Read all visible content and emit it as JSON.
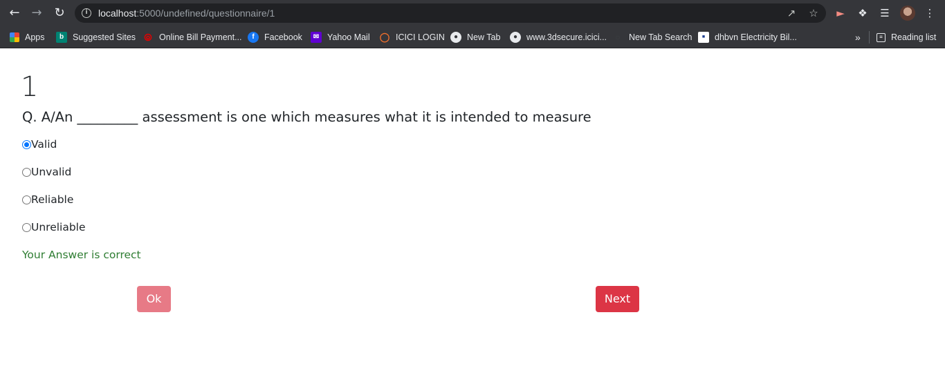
{
  "browser": {
    "url_host": "localhost",
    "url_rest": ":5000/undefined/questionnaire/1",
    "bookmarks": [
      {
        "label": "Apps",
        "icon": "apps-grid-icon"
      },
      {
        "label": "Suggested Sites",
        "icon": "bing-icon"
      },
      {
        "label": "Online Bill Payment...",
        "icon": "airtel-icon"
      },
      {
        "label": "Facebook",
        "icon": "facebook-icon"
      },
      {
        "label": "Yahoo Mail",
        "icon": "yahoo-mail-icon"
      },
      {
        "label": "ICICI LOGIN",
        "icon": "icici-icon"
      },
      {
        "label": "New Tab",
        "icon": "globe-icon"
      },
      {
        "label": "www.3dsecure.icici...",
        "icon": "globe-icon"
      },
      {
        "label": "New Tab Search",
        "icon": "search-dot-icon"
      },
      {
        "label": "dhbvn Electricity Bil...",
        "icon": "dhbvn-icon"
      }
    ],
    "more_bookmarks": "»",
    "reading_list": "Reading list"
  },
  "question": {
    "number": "1",
    "text": "Q. A/An _________ assessment is one which measures what it is intended to measure",
    "options": [
      {
        "label": "Valid",
        "selected": true
      },
      {
        "label": "Unvalid",
        "selected": false
      },
      {
        "label": "Reliable",
        "selected": false
      },
      {
        "label": "Unreliable",
        "selected": false
      }
    ],
    "feedback": "Your Answer is correct"
  },
  "buttons": {
    "ok_label": "Ok",
    "next_label": "Next"
  },
  "colors": {
    "feedback": "#2e7d32",
    "ok_button": "#e77a86",
    "next_button": "#dc3545",
    "radio_checked": "#0075ff"
  }
}
